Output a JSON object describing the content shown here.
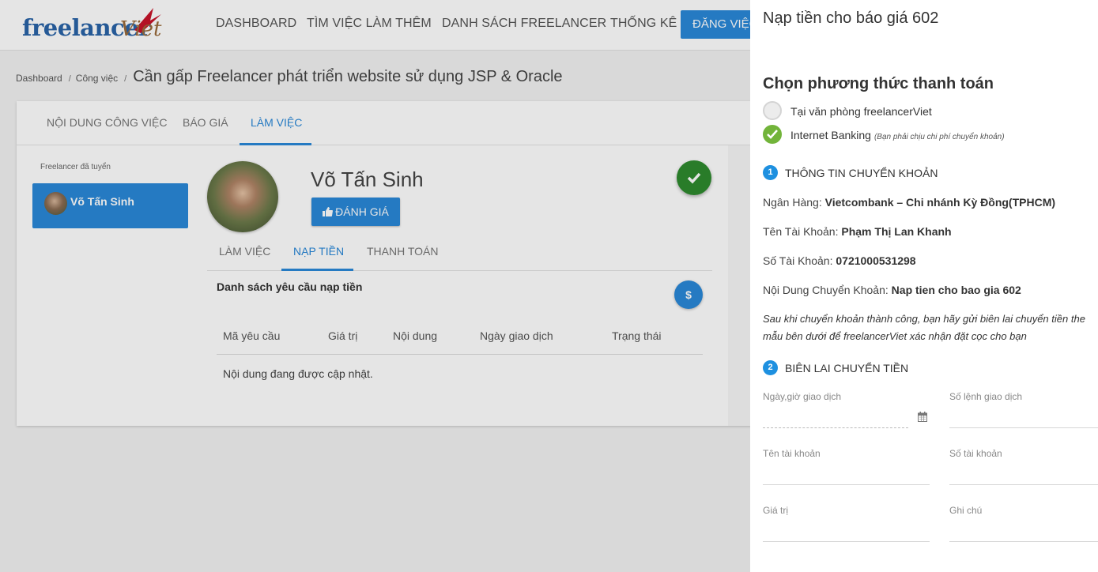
{
  "navbar": {
    "logo": {
      "part1": "freelancer",
      "part2": "Viet"
    },
    "items": [
      "DASHBOARD",
      "TÌM VIỆC LÀM THÊM",
      "DANH SÁCH FREELANCER",
      "THỐNG KÊ"
    ],
    "post_button": "ĐĂNG VIỆC"
  },
  "breadcrumb": {
    "items": [
      "Dashboard",
      "Công việc"
    ],
    "title": "Cần gấp Freelancer phát triển website sử dụng JSP & Oracle"
  },
  "tabs": [
    "NỘI DUNG CÔNG VIỆC",
    "BÁO GIÁ",
    "LÀM VIỆC"
  ],
  "left": {
    "title": "Freelancer đã tuyển",
    "freelancer_name": "Võ Tấn Sinh"
  },
  "profile": {
    "name": "Võ Tấn Sinh",
    "rate_button": "ĐÁNH GIÁ"
  },
  "subtabs": [
    "LÀM VIỆC",
    "NẠP TIỀN",
    "THANH TOÁN"
  ],
  "deposit": {
    "title": "Danh sách yêu cầu nạp tiền",
    "add_button": "$",
    "columns": [
      "Mã yêu cầu",
      "Giá trị",
      "Nội dung",
      "Ngày giao dịch",
      "Trạng thái"
    ],
    "empty_text": "Nội dung đang được cập nhật."
  },
  "drawer": {
    "title": "Nạp tiền cho báo giá 602",
    "method_heading": "Chọn phương thức thanh toán",
    "options": [
      {
        "label": "Tại văn phòng freelancerViet",
        "selected": false
      },
      {
        "label": "Internet Banking",
        "note": "(Bạn phải chịu chi phí chuyển khoản)",
        "selected": true
      }
    ],
    "section1": {
      "num": "1",
      "title": "THÔNG TIN CHUYỂN KHOẢN"
    },
    "bank_info": [
      {
        "label": "Ngân Hàng:",
        "value": "Vietcombank – Chi nhánh Kỳ Đồng(TPHCM)"
      },
      {
        "label": "Tên Tài Khoản:",
        "value": "Phạm Thị Lan Khanh"
      },
      {
        "label": "Số Tài Khoản:",
        "value": "0721000531298"
      },
      {
        "label": "Nội Dung Chuyển Khoản:",
        "value": "Nap tien cho bao gia 602"
      }
    ],
    "note_line1": "Sau khi chuyển khoản thành công, bạn hãy gửi biên lai chuyển tiền the",
    "note_line2": "mẫu bên dưới để freelancerViet xác nhận đặt cọc cho bạn",
    "section2": {
      "num": "2",
      "title": "BIÊN LAI CHUYỂN TIỀN"
    },
    "fields": {
      "datetime": "Ngày,giờ giao dịch",
      "order_no": "Số lệnh giao dịch",
      "account_name": "Tên tài khoản",
      "account_no": "Số tài khoản",
      "amount": "Giá trị",
      "note": "Ghi chú"
    }
  },
  "colors": {
    "primary": "#2a88d8",
    "success": "#2e8b2e",
    "radio_checked": "#72b43a",
    "section_badge": "#1e90e0"
  }
}
